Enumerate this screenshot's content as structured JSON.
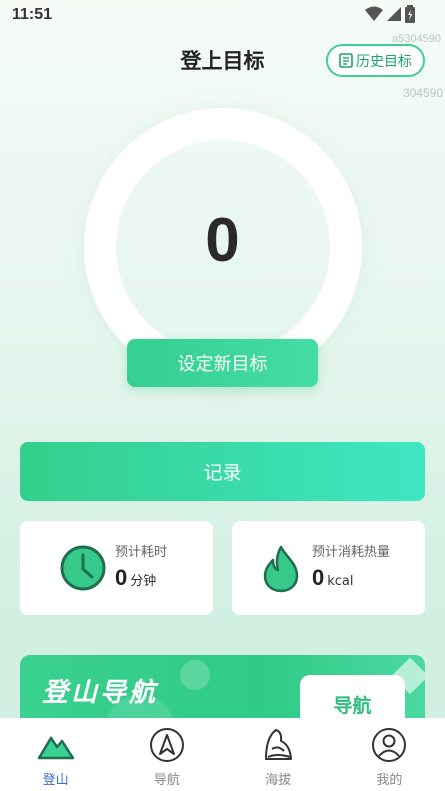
{
  "status_bar": {
    "time": "11:51"
  },
  "watermarks": {
    "top": "a5304590",
    "right": "304590"
  },
  "header": {
    "title": "登上目标",
    "history_label": "历史目标"
  },
  "goal": {
    "value": "0",
    "set_goal_label": "设定新目标"
  },
  "record_label": "记录",
  "stats": {
    "time": {
      "label": "预计耗时",
      "value": "0",
      "unit": "分钟"
    },
    "calories": {
      "label": "预计消耗热量",
      "value": "0",
      "unit": "kcal"
    }
  },
  "banner": {
    "title": "登山导航",
    "button_label": "导航"
  },
  "tabs": [
    {
      "label": "登山",
      "icon": "mountain-icon",
      "active": true
    },
    {
      "label": "导航",
      "icon": "compass-icon",
      "active": false
    },
    {
      "label": "海拔",
      "icon": "altitude-icon",
      "active": false
    },
    {
      "label": "我的",
      "icon": "profile-icon",
      "active": false
    }
  ],
  "colors": {
    "accent": "#35cf8f",
    "active_tab": "#3d6fd0",
    "icon_green": "#1f6e4f"
  }
}
